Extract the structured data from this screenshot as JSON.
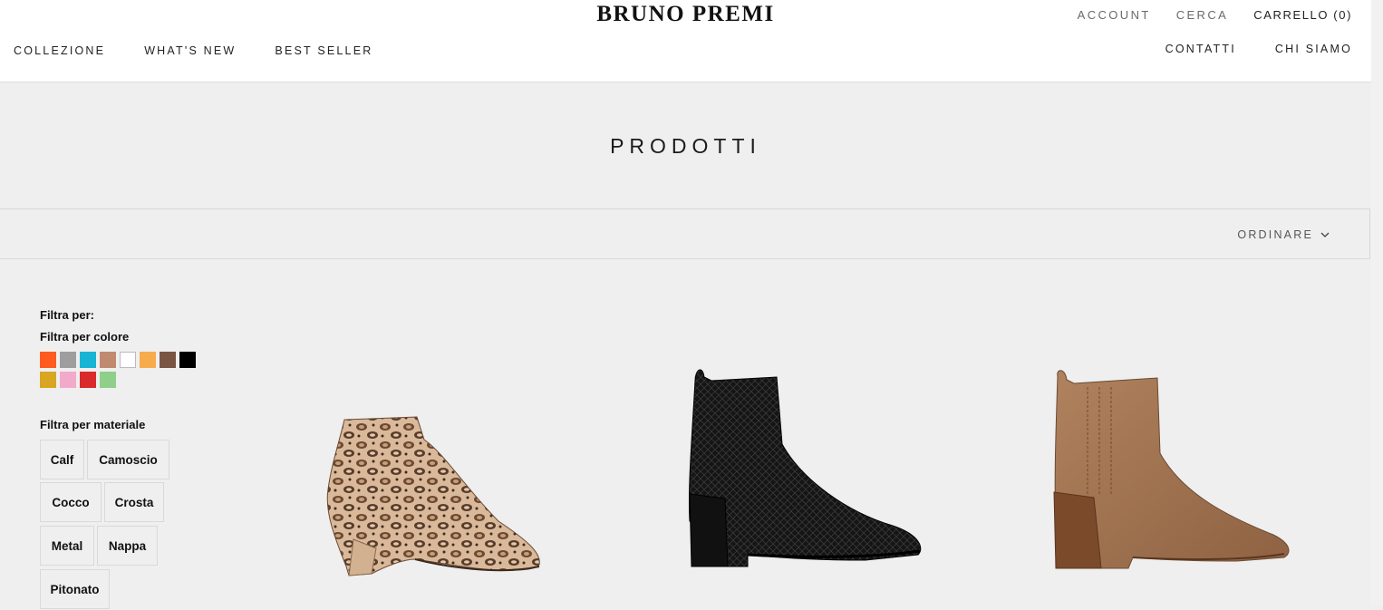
{
  "header": {
    "logo": "BRUNO PREMI",
    "nav_left": [
      "COLLEZIONE",
      "WHAT'S NEW",
      "BEST SELLER"
    ],
    "account": "ACCOUNT",
    "search": "CERCA",
    "cart": "CARRELLO (0)",
    "contact": "CONTATTI",
    "about": "CHI SIAMO"
  },
  "page": {
    "title": "PRODOTTI"
  },
  "toolbar": {
    "sort_label": "ORDINARE",
    "sort_icon": "chevron-down-icon"
  },
  "filters": {
    "heading": "Filtra per:",
    "color_heading": "Filtra per colore",
    "colors": [
      "#ff5a1f",
      "#9e9e9e",
      "#18b4d4",
      "#c08a70",
      "#ffffff",
      "#f6ac4c",
      "#7a5544",
      "#000000",
      "#d8a620",
      "#f2aacb",
      "#d92b2b",
      "#8fcf8a"
    ],
    "material_heading": "Filtra per materiale",
    "materials": [
      "Calf",
      "Camoscio",
      "Cocco",
      "Crosta",
      "Metal",
      "Nappa",
      "Pitonato"
    ]
  },
  "products": [
    {
      "image": "python-print ankle boot"
    },
    {
      "image": "black croc-embossed ankle boot"
    },
    {
      "image": "tan suede ankle boot"
    }
  ]
}
